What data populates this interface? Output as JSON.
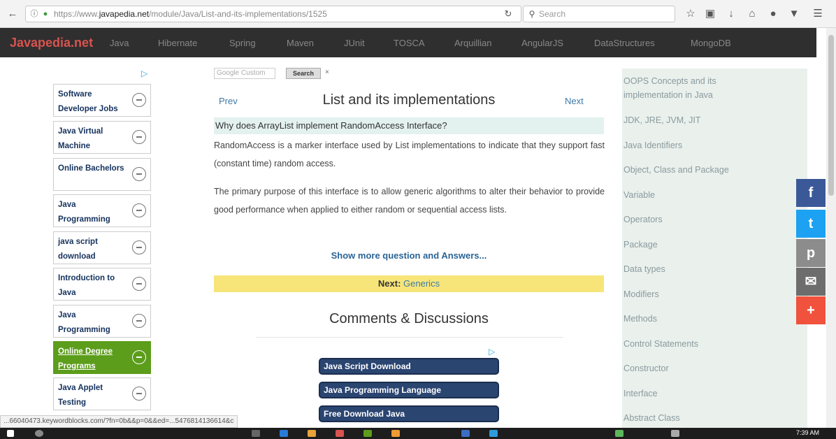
{
  "browser": {
    "url_prefix": "https://www.",
    "url_domain": "javapedia.net",
    "url_path": "/module/Java/List-and-its-implementations/1525",
    "search_placeholder": "Search"
  },
  "nav": {
    "logo": "Javapedia.net",
    "items": [
      "Java",
      "Hibernate",
      "Spring",
      "Maven",
      "JUnit",
      "TOSCA",
      "Arquillian",
      "AngularJS",
      "DataStructures",
      "MongoDB"
    ]
  },
  "left_ads": {
    "adchoice": "▷",
    "items": [
      {
        "label": "Software Developer Jobs"
      },
      {
        "label": "Java Virtual Machine"
      },
      {
        "label": "Online Bachelors"
      },
      {
        "label": "Java Programming"
      },
      {
        "label": "java script download"
      },
      {
        "label": "Introduction to Java"
      },
      {
        "label": "Java Programming"
      },
      {
        "label": "Online Degree Programs"
      },
      {
        "label": "Java Applet Testing"
      }
    ]
  },
  "main": {
    "google_search": "Google  Custom",
    "search_button": "Search",
    "search_clear": "×",
    "prev": "Prev",
    "next": "Next",
    "title": "List and its implementations",
    "question": "Why does ArrayList implement RandomAccess Interface?",
    "para1": "RandomAccess is a marker interface used by List implementations to indicate that they support fast (constant time) random access.",
    "para2": "The primary purpose of this interface is to allow generic algorithms to alter their behavior to provide good performance when applied to either random or sequential access lists.",
    "show_more": "Show more question and Answers...",
    "next_label": "Next:",
    "next_topic": "Generics",
    "comments_title": "Comments & Discussions",
    "ad_links": [
      "Java Script Download",
      "Java Programming Language",
      "Free Download Java"
    ]
  },
  "right_links": [
    "OOPS Concepts and its implementation in Java",
    "JDK, JRE, JVM, JIT",
    "Java Identifiers",
    "Object, Class and Package",
    "Variable",
    "Operators",
    "Package",
    "Data types",
    "Modifiers",
    "Methods",
    "Control Statements",
    "Constructor",
    "Interface",
    "Abstract Class"
  ],
  "share": {
    "facebook": "f",
    "twitter": "t",
    "pinterest": "p",
    "email": "✉",
    "more": "+",
    "colors": {
      "facebook": "#3b5998",
      "twitter": "#1da1f2",
      "pinterest": "#8c8c8c",
      "email": "#6d6d6d",
      "more": "#f0523d"
    }
  },
  "status_text": "...66040473.keywordblocks.com/?fn=0b&&p=0&&ed=...5476814136614&c",
  "clock": "7:39 AM"
}
